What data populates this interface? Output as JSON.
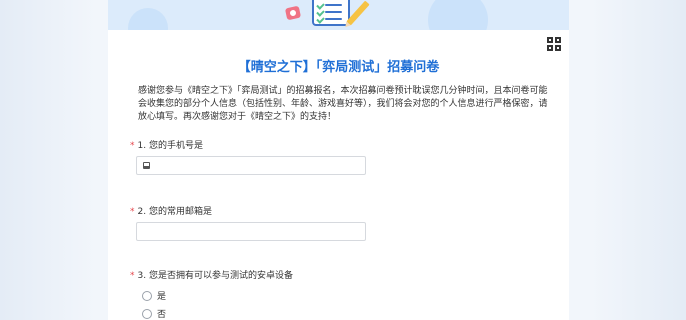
{
  "form": {
    "title": "【晴空之下】「弈局测试」招募问卷",
    "intro": "感谢您参与《晴空之下》「弈局测试」的招募报名，本次招募问卷预计耽误您几分钟时间，且本问卷可能会收集您的部分个人信息（包括性别、年龄、游戏喜好等），我们将会对您的个人信息进行严格保密，请放心填写。再次感谢您对于《晴空之下》的支持！",
    "required_mark": "*",
    "questions": [
      {
        "label": "1. 您的手机号是",
        "type": "text",
        "value": ""
      },
      {
        "label": "2. 您的常用邮箱是",
        "type": "text",
        "value": ""
      },
      {
        "label": "3. 您是否拥有可以参与测试的安卓设备",
        "type": "radio",
        "options": [
          "是",
          "否"
        ]
      }
    ]
  },
  "icons": {
    "qr": "qr-code-icon",
    "phone": "phone-icon",
    "banner": [
      "emoji-icon",
      "checklist-icon",
      "pencil-icon"
    ]
  },
  "colors": {
    "title": "#1f6fd6",
    "required": "#e5484d",
    "banner": "#dcebfb"
  }
}
